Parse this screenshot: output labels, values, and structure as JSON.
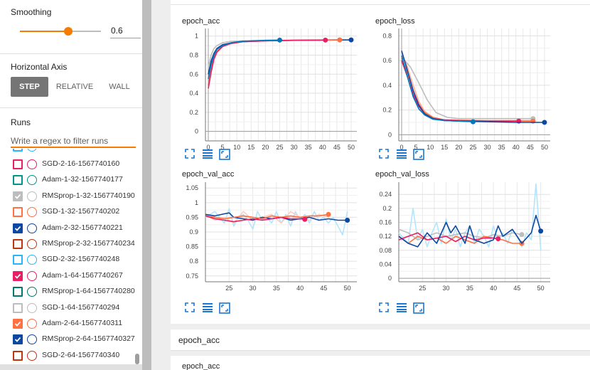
{
  "sidebar": {
    "smoothing": {
      "label": "Smoothing",
      "value": "0.6",
      "fraction": 0.6
    },
    "horizontal_axis": {
      "label": "Horizontal Axis",
      "options": [
        "STEP",
        "RELATIVE",
        "WALL"
      ],
      "selected": "STEP"
    },
    "runs": {
      "label": "Runs",
      "filter_placeholder": "Write a regex to filter runs",
      "items": [
        {
          "label": "SGD-2-16-1567740160",
          "checked": false,
          "color": "#e91e63"
        },
        {
          "label": "Adam-1-32-1567740177",
          "checked": false,
          "color": "#009688"
        },
        {
          "label": "RMSprop-1-32-1567740190",
          "checked": true,
          "color": "#bdbdbd"
        },
        {
          "label": "SGD-1-32-1567740202",
          "checked": false,
          "color": "#ff7043"
        },
        {
          "label": "Adam-2-32-1567740221",
          "checked": true,
          "color": "#0d47a1"
        },
        {
          "label": "RMSprop-2-32-1567740234",
          "checked": false,
          "color": "#bf360c"
        },
        {
          "label": "SGD-2-32-1567740248",
          "checked": false,
          "color": "#29b6f6"
        },
        {
          "label": "Adam-1-64-1567740267",
          "checked": true,
          "color": "#e91e63"
        },
        {
          "label": "RMSprop-1-64-1567740280",
          "checked": false,
          "color": "#00796b"
        },
        {
          "label": "SGD-1-64-1567740294",
          "checked": false,
          "color": "#bdbdbd"
        },
        {
          "label": "Adam-2-64-1567740311",
          "checked": true,
          "color": "#ff7043"
        },
        {
          "label": "RMSprop-2-64-1567740327",
          "checked": true,
          "color": "#0d47a1"
        },
        {
          "label": "SGD-2-64-1567740340",
          "checked": false,
          "color": "#bf360c"
        }
      ]
    }
  },
  "main": {
    "section_header": "epoch_acc",
    "next_chart_title": "epoch_acc"
  },
  "chart_data": [
    {
      "type": "line",
      "title": "epoch_acc",
      "xlim": [
        -1,
        52
      ],
      "ylim": [
        -0.1,
        1.08
      ],
      "xticks": [
        0,
        5,
        10,
        15,
        20,
        25,
        30,
        35,
        40,
        45,
        50
      ],
      "yticks": [
        0,
        0.2,
        0.4,
        0.6,
        0.8,
        1
      ],
      "series": [
        {
          "color": "#bdbdbd",
          "x": [
            0,
            1,
            2,
            3,
            5,
            8,
            12,
            20,
            30,
            40,
            46
          ],
          "y": [
            0.68,
            0.8,
            0.87,
            0.9,
            0.93,
            0.945,
            0.95,
            0.955,
            0.958,
            0.96,
            0.96
          ],
          "end_marker": true
        },
        {
          "color": "#0d47a1",
          "x": [
            0,
            1,
            2,
            3,
            5,
            8,
            12,
            20,
            30,
            40,
            50
          ],
          "y": [
            0.6,
            0.74,
            0.82,
            0.87,
            0.91,
            0.93,
            0.945,
            0.952,
            0.955,
            0.958,
            0.96
          ],
          "end_marker": true
        },
        {
          "color": "#ff7043",
          "x": [
            0,
            1,
            2,
            3,
            5,
            8,
            12,
            20,
            30,
            40,
            46
          ],
          "y": [
            0.48,
            0.66,
            0.78,
            0.84,
            0.89,
            0.92,
            0.94,
            0.95,
            0.955,
            0.958,
            0.96
          ],
          "end_marker": true
        },
        {
          "color": "#e91e63",
          "x": [
            0,
            1,
            2,
            3,
            5,
            8,
            12,
            20,
            30,
            41
          ],
          "y": [
            0.45,
            0.62,
            0.76,
            0.83,
            0.89,
            0.925,
            0.94,
            0.95,
            0.955,
            0.958
          ],
          "end_marker": true
        },
        {
          "color": "#0277bd",
          "x": [
            0,
            1,
            2,
            3,
            5,
            8,
            12,
            20,
            25
          ],
          "y": [
            0.55,
            0.7,
            0.8,
            0.86,
            0.9,
            0.93,
            0.945,
            0.955,
            0.958
          ],
          "end_marker": true
        }
      ]
    },
    {
      "type": "line",
      "title": "epoch_loss",
      "xlim": [
        -1,
        52
      ],
      "ylim": [
        -0.05,
        0.86
      ],
      "xticks": [
        0,
        5,
        10,
        15,
        20,
        25,
        30,
        35,
        40,
        45,
        50
      ],
      "yticks": [
        0,
        0.2,
        0.4,
        0.6,
        0.8
      ],
      "series": [
        {
          "color": "#bdbdbd",
          "x": [
            0,
            3,
            6,
            9,
            12,
            16,
            20,
            30,
            40,
            46
          ],
          "y": [
            0.63,
            0.55,
            0.42,
            0.28,
            0.18,
            0.14,
            0.13,
            0.13,
            0.13,
            0.13
          ],
          "end_marker": true
        },
        {
          "color": "#ffab91",
          "x": [
            0,
            2,
            4,
            6,
            8,
            11,
            15,
            20,
            30,
            46
          ],
          "y": [
            0.66,
            0.55,
            0.4,
            0.27,
            0.19,
            0.14,
            0.12,
            0.12,
            0.115,
            0.115
          ],
          "end_marker": false
        },
        {
          "color": "#ff7043",
          "x": [
            0,
            2,
            4,
            6,
            8,
            11,
            15,
            20,
            30,
            46
          ],
          "y": [
            0.62,
            0.5,
            0.36,
            0.25,
            0.18,
            0.14,
            0.12,
            0.115,
            0.11,
            0.11
          ],
          "end_marker": true
        },
        {
          "color": "#e91e63",
          "x": [
            0,
            2,
            4,
            6,
            8,
            11,
            15,
            20,
            30,
            41
          ],
          "y": [
            0.6,
            0.47,
            0.33,
            0.23,
            0.17,
            0.13,
            0.12,
            0.115,
            0.11,
            0.11
          ],
          "end_marker": true
        },
        {
          "color": "#0d47a1",
          "x": [
            0,
            2,
            4,
            6,
            8,
            11,
            15,
            20,
            30,
            40,
            50
          ],
          "y": [
            0.68,
            0.52,
            0.36,
            0.24,
            0.17,
            0.13,
            0.115,
            0.11,
            0.105,
            0.1,
            0.1
          ],
          "end_marker": true
        },
        {
          "color": "#0277bd",
          "x": [
            0,
            2,
            4,
            6,
            8,
            11,
            15,
            20,
            25
          ],
          "y": [
            0.64,
            0.47,
            0.31,
            0.21,
            0.16,
            0.125,
            0.115,
            0.11,
            0.105
          ],
          "end_marker": true
        }
      ]
    },
    {
      "type": "line",
      "title": "epoch_val_acc",
      "xlim": [
        20,
        52
      ],
      "ylim": [
        0.73,
        1.07
      ],
      "xticks": [
        25,
        30,
        35,
        40,
        45,
        50
      ],
      "yticks": [
        0.75,
        0.8,
        0.85,
        0.9,
        0.95,
        1,
        1.05
      ],
      "series": [
        {
          "color": "#b3e5fc",
          "x": [
            20,
            22,
            24,
            25,
            26,
            27,
            28,
            29,
            30,
            31,
            32,
            33,
            34,
            35,
            36,
            37,
            38,
            39,
            40,
            41,
            42,
            43,
            44,
            45,
            46,
            47,
            48,
            49,
            50
          ],
          "y": [
            0.95,
            0.97,
            0.93,
            0.98,
            0.92,
            0.95,
            0.96,
            0.94,
            0.91,
            0.97,
            0.94,
            0.95,
            0.93,
            0.97,
            0.93,
            0.96,
            0.92,
            0.97,
            0.94,
            0.96,
            0.93,
            0.97,
            0.94,
            0.95,
            0.93,
            0.95,
            0.92,
            0.89,
            0.97
          ],
          "end_marker": false
        },
        {
          "color": "#ffccbc",
          "x": [
            20,
            22,
            24,
            26,
            28,
            30,
            32,
            34,
            36,
            38,
            40,
            42,
            44,
            46
          ],
          "y": [
            0.96,
            0.94,
            0.95,
            0.93,
            0.97,
            0.94,
            0.95,
            0.96,
            0.93,
            0.97,
            0.95,
            0.94,
            0.96,
            0.95
          ],
          "end_marker": false
        },
        {
          "color": "#0d47a1",
          "x": [
            20,
            22,
            24,
            25,
            26,
            28,
            30,
            32,
            34,
            36,
            38,
            40,
            42,
            44,
            46,
            48,
            50
          ],
          "y": [
            0.96,
            0.955,
            0.962,
            0.965,
            0.95,
            0.945,
            0.94,
            0.95,
            0.945,
            0.95,
            0.94,
            0.945,
            0.95,
            0.94,
            0.945,
            0.94,
            0.94
          ],
          "end_marker": true
        },
        {
          "color": "#ff7043",
          "x": [
            20,
            22,
            24,
            26,
            28,
            30,
            32,
            34,
            36,
            38,
            40,
            42,
            44,
            46
          ],
          "y": [
            0.955,
            0.95,
            0.945,
            0.95,
            0.955,
            0.95,
            0.945,
            0.955,
            0.95,
            0.955,
            0.95,
            0.955,
            0.955,
            0.96
          ],
          "end_marker": true
        },
        {
          "color": "#e91e63",
          "x": [
            20,
            22,
            24,
            26,
            28,
            30,
            32,
            34,
            36,
            38,
            40,
            41
          ],
          "y": [
            0.955,
            0.945,
            0.94,
            0.935,
            0.94,
            0.945,
            0.94,
            0.945,
            0.95,
            0.945,
            0.945,
            0.943
          ],
          "end_marker": true
        }
      ]
    },
    {
      "type": "line",
      "title": "epoch_val_loss",
      "xlim": [
        20,
        52
      ],
      "ylim": [
        -0.01,
        0.275
      ],
      "xticks": [
        25,
        30,
        35,
        40,
        45,
        50
      ],
      "yticks": [
        0,
        0.04,
        0.08,
        0.12,
        0.16,
        0.2,
        0.24
      ],
      "series": [
        {
          "color": "#b3e5fc",
          "x": [
            20,
            22,
            23,
            24,
            25,
            26,
            27,
            28,
            29,
            30,
            31,
            32,
            33,
            34,
            35,
            36,
            37,
            38,
            39,
            40,
            41,
            42,
            43,
            44,
            45,
            46,
            47,
            48,
            49,
            50
          ],
          "y": [
            0.13,
            0.1,
            0.2,
            0.11,
            0.14,
            0.09,
            0.13,
            0.16,
            0.1,
            0.17,
            0.11,
            0.14,
            0.09,
            0.13,
            0.15,
            0.1,
            0.14,
            0.12,
            0.09,
            0.15,
            0.11,
            0.13,
            0.1,
            0.14,
            0.12,
            0.09,
            0.13,
            0.11,
            0.27,
            0.08
          ],
          "end_marker": false
        },
        {
          "color": "#bdbdbd",
          "x": [
            20,
            22,
            24,
            26,
            28,
            30,
            32,
            34,
            36,
            38,
            40,
            42,
            44,
            46
          ],
          "y": [
            0.14,
            0.13,
            0.11,
            0.12,
            0.13,
            0.12,
            0.125,
            0.13,
            0.12,
            0.115,
            0.125,
            0.12,
            0.13,
            0.125
          ],
          "end_marker": true
        },
        {
          "color": "#ff7043",
          "x": [
            20,
            22,
            24,
            26,
            28,
            30,
            32,
            34,
            36,
            38,
            40,
            42,
            44,
            46
          ],
          "y": [
            0.12,
            0.1,
            0.12,
            0.11,
            0.115,
            0.1,
            0.12,
            0.11,
            0.1,
            0.12,
            0.115,
            0.11,
            0.1,
            0.1
          ],
          "end_marker": true
        },
        {
          "color": "#e91e63",
          "x": [
            20,
            22,
            24,
            26,
            28,
            30,
            32,
            34,
            36,
            38,
            40,
            41
          ],
          "y": [
            0.11,
            0.12,
            0.13,
            0.11,
            0.115,
            0.12,
            0.105,
            0.12,
            0.11,
            0.115,
            0.115,
            0.113
          ],
          "end_marker": true
        },
        {
          "color": "#0d47a1",
          "x": [
            20,
            22,
            24,
            25,
            26,
            28,
            30,
            31,
            32,
            34,
            35,
            36,
            38,
            40,
            41,
            42,
            44,
            46,
            48,
            49,
            50
          ],
          "y": [
            0.12,
            0.1,
            0.09,
            0.11,
            0.13,
            0.1,
            0.16,
            0.13,
            0.15,
            0.1,
            0.15,
            0.11,
            0.1,
            0.11,
            0.15,
            0.12,
            0.14,
            0.1,
            0.13,
            0.18,
            0.135
          ],
          "end_marker": true
        }
      ]
    }
  ]
}
